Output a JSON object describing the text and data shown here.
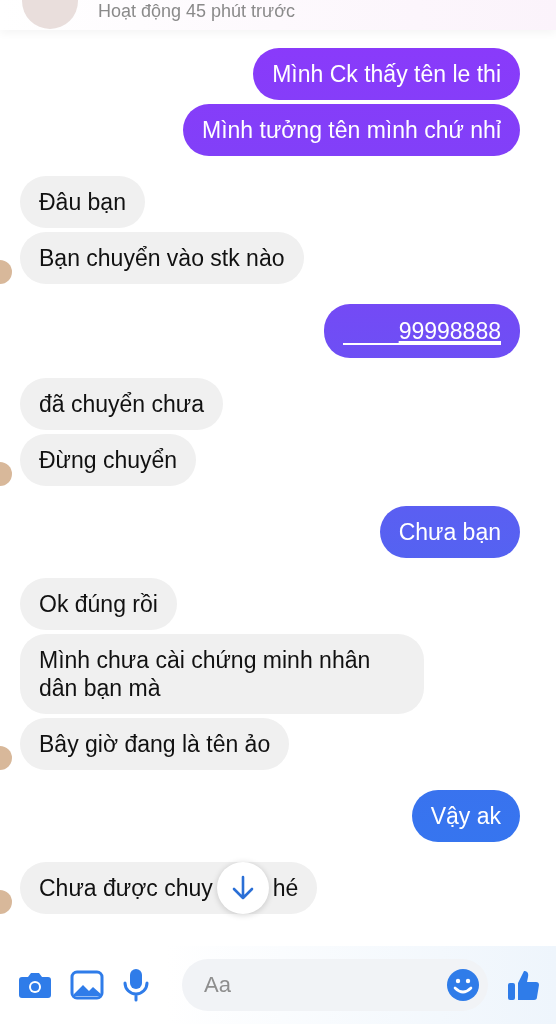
{
  "header": {
    "status": "Hoạt động 45 phút trước"
  },
  "messages": [
    {
      "kind": "outgoing",
      "text": "Mình Ck thấy tên le thi"
    },
    {
      "kind": "outgoing",
      "text": "Mình tưởng tên mình chứ nhỉ"
    },
    {
      "kind": "incoming",
      "text": "Đâu bạn",
      "avatar": false
    },
    {
      "kind": "incoming",
      "text": "Bạn chuyển vào stk nào",
      "avatar": true
    },
    {
      "kind": "link",
      "text": "99998888"
    },
    {
      "kind": "incoming",
      "text": "đã chuyển chưa",
      "avatar": false
    },
    {
      "kind": "incoming",
      "text": "Đừng chuyển",
      "avatar": true
    },
    {
      "kind": "outgoing",
      "text": "Chưa bạn"
    },
    {
      "kind": "incoming",
      "text": "Ok đúng rồi",
      "avatar": false
    },
    {
      "kind": "incoming",
      "text": "Mình chưa cài chứng minh nhân dân bạn mà",
      "avatar": false
    },
    {
      "kind": "incoming",
      "text": "Bây giờ đang là tên ảo",
      "avatar": true
    },
    {
      "kind": "outgoing",
      "text": "Vậy ak"
    },
    {
      "kind": "covered",
      "parts": [
        "Chưa được chuy",
        "hé"
      ],
      "avatar": true
    }
  ],
  "composer": {
    "placeholder": "Aa"
  }
}
